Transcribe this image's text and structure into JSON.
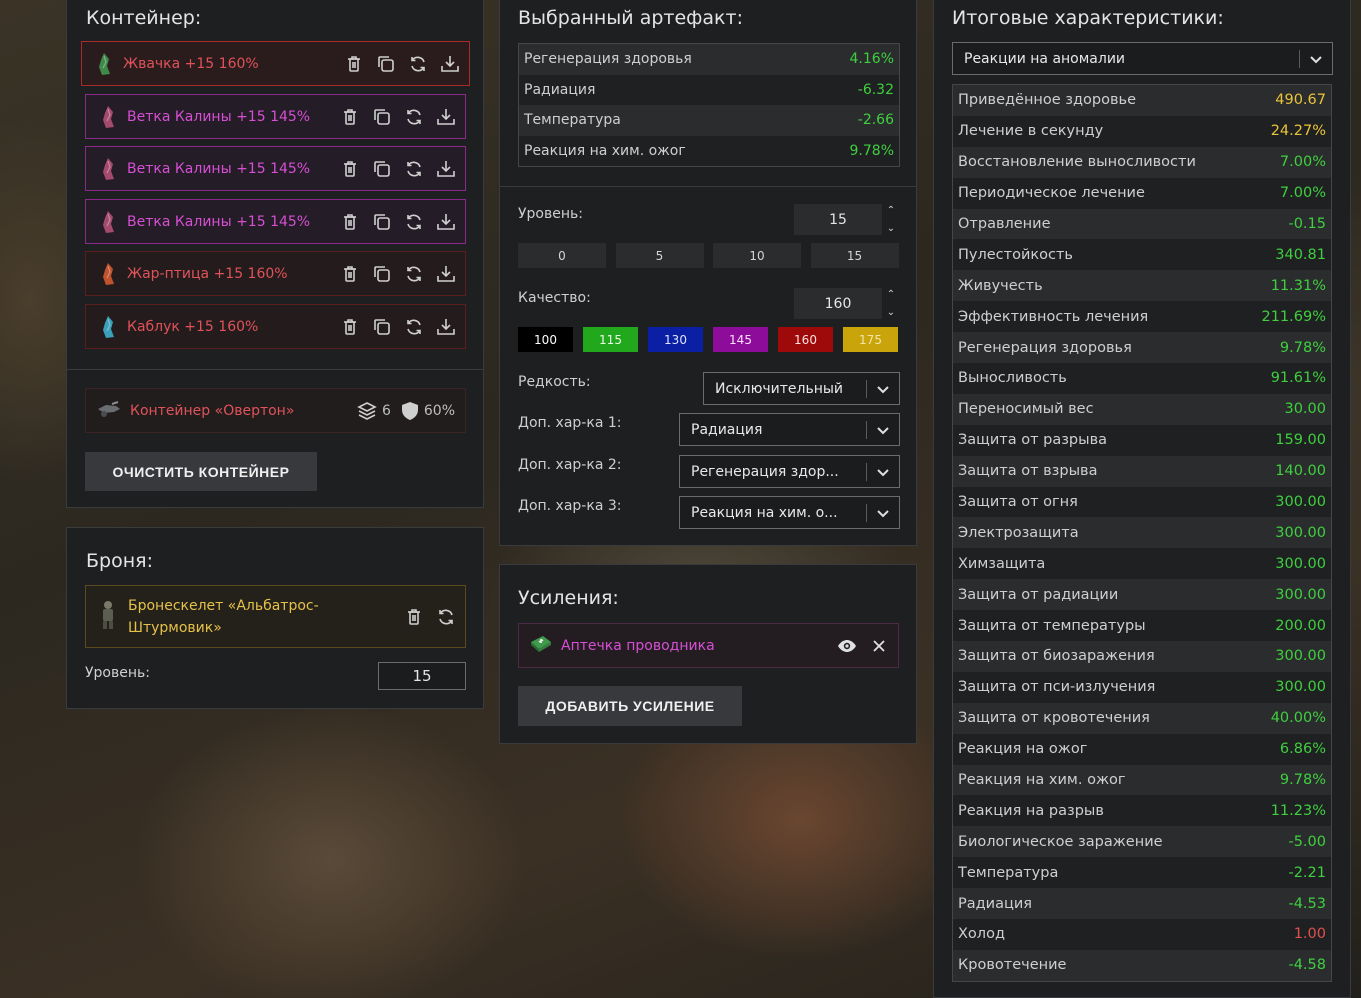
{
  "container": {
    "title": "Контейнер:",
    "items": [
      {
        "name": "Жвачка +15 160%",
        "color": "red",
        "selected": true
      },
      {
        "name": "Ветка Калины +15 145%",
        "color": "pink"
      },
      {
        "name": "Ветка Калины +15 145%",
        "color": "pink"
      },
      {
        "name": "Ветка Калины +15 145%",
        "color": "pink"
      },
      {
        "name": "Жар-птица +15 160%",
        "color": "red"
      },
      {
        "name": "Каблук +15 160%",
        "color": "red"
      }
    ],
    "container_name": "Контейнер «Овертон»",
    "slots": "6",
    "protection": "60%",
    "clear_label": "ОЧИСТИТЬ КОНТЕЙНЕР"
  },
  "armor": {
    "title": "Броня:",
    "name": "Бронескелет «Альбатрос-Штурмовик»",
    "level_label": "Уровень:",
    "level_value": "15"
  },
  "artifact": {
    "title": "Выбранный артефакт:",
    "stats": [
      {
        "label": "Регенерация здоровья",
        "value": "4.16%",
        "tone": "green"
      },
      {
        "label": "Радиация",
        "value": "-6.32",
        "tone": "green"
      },
      {
        "label": "Температура",
        "value": "-2.66",
        "tone": "green"
      },
      {
        "label": "Реакция на хим. ожог",
        "value": "9.78%",
        "tone": "green"
      }
    ],
    "level_label": "Уровень:",
    "level_value": "15",
    "level_presets": [
      "0",
      "5",
      "10",
      "15"
    ],
    "quality_label": "Качество:",
    "quality_value": "160",
    "quality_presets": [
      {
        "label": "100",
        "bg": "#000000",
        "fg": "#ffffff"
      },
      {
        "label": "115",
        "bg": "#22a81c",
        "fg": "#e8ffe8"
      },
      {
        "label": "130",
        "bg": "#0a1fa3",
        "fg": "#dfe4ff"
      },
      {
        "label": "145",
        "bg": "#8d0c99",
        "fg": "#ffe0ff"
      },
      {
        "label": "160",
        "bg": "#9e0a0a",
        "fg": "#ffe0e0"
      },
      {
        "label": "175",
        "bg": "#c9a40a",
        "fg": "#f3e6a8"
      }
    ],
    "rarity_label": "Редкость:",
    "rarity_value": "Исключительный",
    "extra1_label": "Доп. хар-ка 1:",
    "extra1_value": "Радиация",
    "extra2_label": "Доп. хар-ка 2:",
    "extra2_value": "Регенерация здор...",
    "extra3_label": "Доп. хар-ка 3:",
    "extra3_value": "Реакция на хим. о..."
  },
  "boosts": {
    "title": "Усиления:",
    "items": [
      {
        "name": "Аптечка проводника"
      }
    ],
    "add_label": "ДОБАВИТЬ УСИЛЕНИЕ"
  },
  "totals": {
    "title": "Итоговые характеристики:",
    "filter_value": "Реакции на аномалии",
    "stats": [
      {
        "label": "Приведённое здоровье",
        "value": "490.67",
        "tone": "yellow"
      },
      {
        "label": "Лечение в секунду",
        "value": "24.27%",
        "tone": "yellow"
      },
      {
        "label": "Восстановление выносливости",
        "value": "7.00%",
        "tone": "green"
      },
      {
        "label": "Периодическое лечение",
        "value": "7.00%",
        "tone": "green"
      },
      {
        "label": "Отравление",
        "value": "-0.15",
        "tone": "green"
      },
      {
        "label": "Пулестойкость",
        "value": "340.81",
        "tone": "green"
      },
      {
        "label": "Живучесть",
        "value": "11.31%",
        "tone": "green"
      },
      {
        "label": "Эффективность лечения",
        "value": "211.69%",
        "tone": "green"
      },
      {
        "label": "Регенерация здоровья",
        "value": "9.78%",
        "tone": "green"
      },
      {
        "label": "Выносливость",
        "value": "91.61%",
        "tone": "green"
      },
      {
        "label": "Переносимый вес",
        "value": "30.00",
        "tone": "green"
      },
      {
        "label": "Защита от разрыва",
        "value": "159.00",
        "tone": "green"
      },
      {
        "label": "Защита от взрыва",
        "value": "140.00",
        "tone": "green"
      },
      {
        "label": "Защита от огня",
        "value": "300.00",
        "tone": "green"
      },
      {
        "label": "Электрозащита",
        "value": "300.00",
        "tone": "green"
      },
      {
        "label": "Химзащита",
        "value": "300.00",
        "tone": "green"
      },
      {
        "label": "Защита от радиации",
        "value": "300.00",
        "tone": "green"
      },
      {
        "label": "Защита от температуры",
        "value": "200.00",
        "tone": "green"
      },
      {
        "label": "Защита от биозаражения",
        "value": "300.00",
        "tone": "green"
      },
      {
        "label": "Защита от пси-излучения",
        "value": "300.00",
        "tone": "green"
      },
      {
        "label": "Защита от кровотечения",
        "value": "40.00%",
        "tone": "green"
      },
      {
        "label": "Реакция на ожог",
        "value": "6.86%",
        "tone": "green"
      },
      {
        "label": "Реакция на хим. ожог",
        "value": "9.78%",
        "tone": "green"
      },
      {
        "label": "Реакция на разрыв",
        "value": "11.23%",
        "tone": "green"
      },
      {
        "label": "Биологическое заражение",
        "value": "-5.00",
        "tone": "green"
      },
      {
        "label": "Температура",
        "value": "-2.21",
        "tone": "green"
      },
      {
        "label": "Радиация",
        "value": "-4.53",
        "tone": "green"
      },
      {
        "label": "Холод",
        "value": "1.00",
        "tone": "red"
      },
      {
        "label": "Кровотечение",
        "value": "-4.58",
        "tone": "green"
      }
    ]
  }
}
